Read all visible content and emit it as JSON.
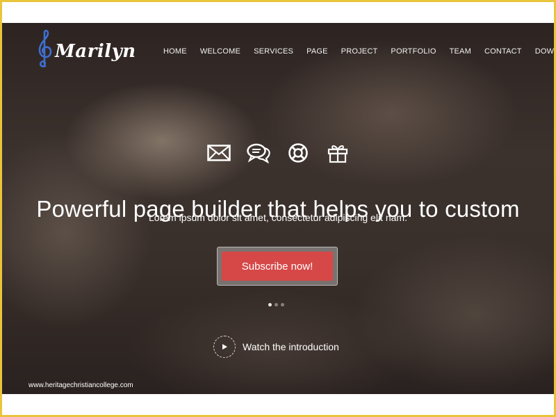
{
  "brand": {
    "name": "Marilyn",
    "icon": "treble-clef-icon",
    "icon_color": "#3f6fd1"
  },
  "nav": {
    "items": [
      "HOME",
      "WELCOME",
      "SERVICES",
      "PAGE",
      "PROJECT",
      "PORTFOLIO",
      "TEAM",
      "CONTACT",
      "DOWNLOAD"
    ]
  },
  "feature_icons": [
    "envelope-icon",
    "chat-bubbles-icon",
    "lifebuoy-icon",
    "gift-icon"
  ],
  "hero": {
    "headline": "Powerful page builder that helps you to custom",
    "subheadline": "Lorem ipsum dolor sit amet, consectetur adipiscing elit nam.",
    "cta_label": "Subscribe now!",
    "cta_color": "#d64848"
  },
  "slider": {
    "count": 3,
    "active_index": 0
  },
  "intro": {
    "label": "Watch the introduction",
    "icon": "play-icon"
  },
  "credit": "www.heritagechristiancollege.com",
  "colors": {
    "frame_border": "#e8c53a"
  }
}
